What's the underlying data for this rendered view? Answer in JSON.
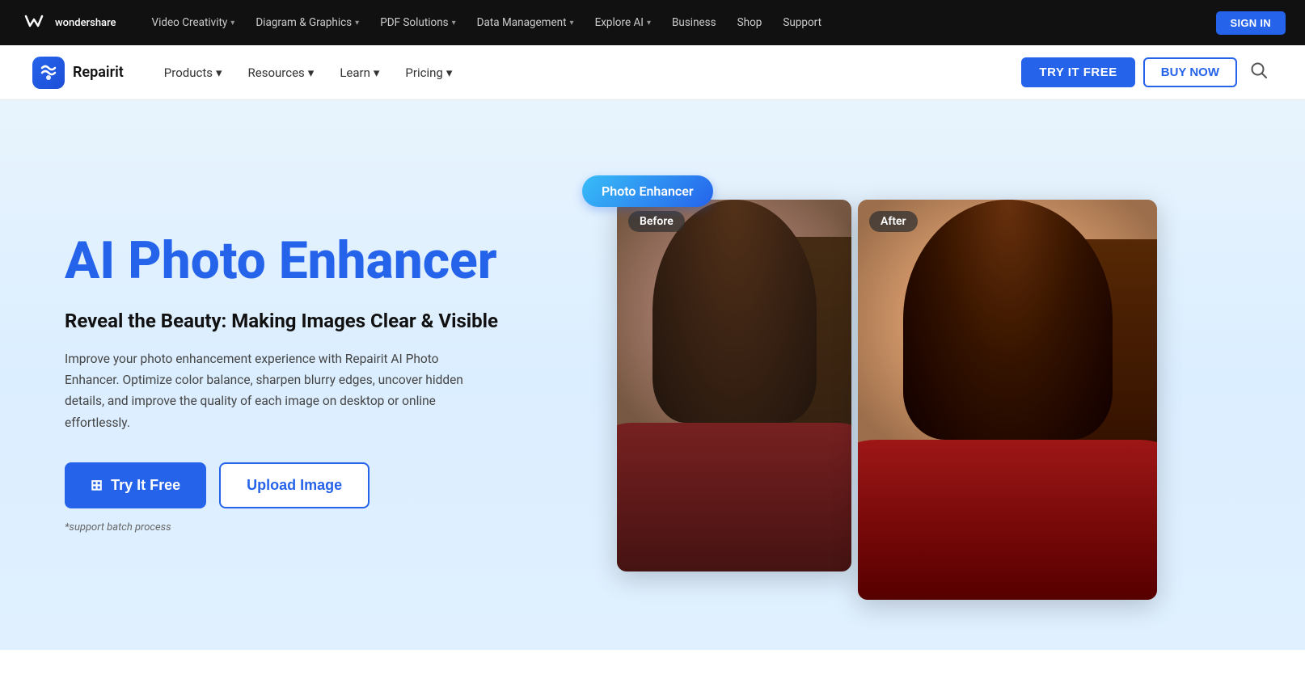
{
  "topNav": {
    "logoText": "wondershare",
    "items": [
      {
        "label": "Video Creativity",
        "hasDropdown": true
      },
      {
        "label": "Diagram & Graphics",
        "hasDropdown": true
      },
      {
        "label": "PDF Solutions",
        "hasDropdown": true
      },
      {
        "label": "Data Management",
        "hasDropdown": true
      },
      {
        "label": "Explore AI",
        "hasDropdown": true
      },
      {
        "label": "Business"
      },
      {
        "label": "Shop"
      },
      {
        "label": "Support"
      }
    ],
    "signInLabel": "SIGN IN"
  },
  "secNav": {
    "brandName": "Repairit",
    "items": [
      {
        "label": "Products",
        "hasDropdown": true
      },
      {
        "label": "Resources",
        "hasDropdown": true
      },
      {
        "label": "Learn",
        "hasDropdown": true
      },
      {
        "label": "Pricing",
        "hasDropdown": true
      }
    ],
    "tryItFreeLabel": "TRY IT FREE",
    "buyNowLabel": "BUY NOW"
  },
  "hero": {
    "badge": "Photo Enhancer",
    "title": "AI Photo Enhancer",
    "subtitle": "Reveal the Beauty: Making Images Clear & Visible",
    "description": "Improve your photo enhancement experience with Repairit AI Photo Enhancer. Optimize color balance, sharpen blurry edges, uncover hidden details, and improve the quality of each image on desktop or online effortlessly.",
    "tryItFreeLabel": "Try It Free",
    "uploadImageLabel": "Upload Image",
    "noteText": "*support batch process",
    "beforeLabel": "Before",
    "afterLabel": "After"
  }
}
